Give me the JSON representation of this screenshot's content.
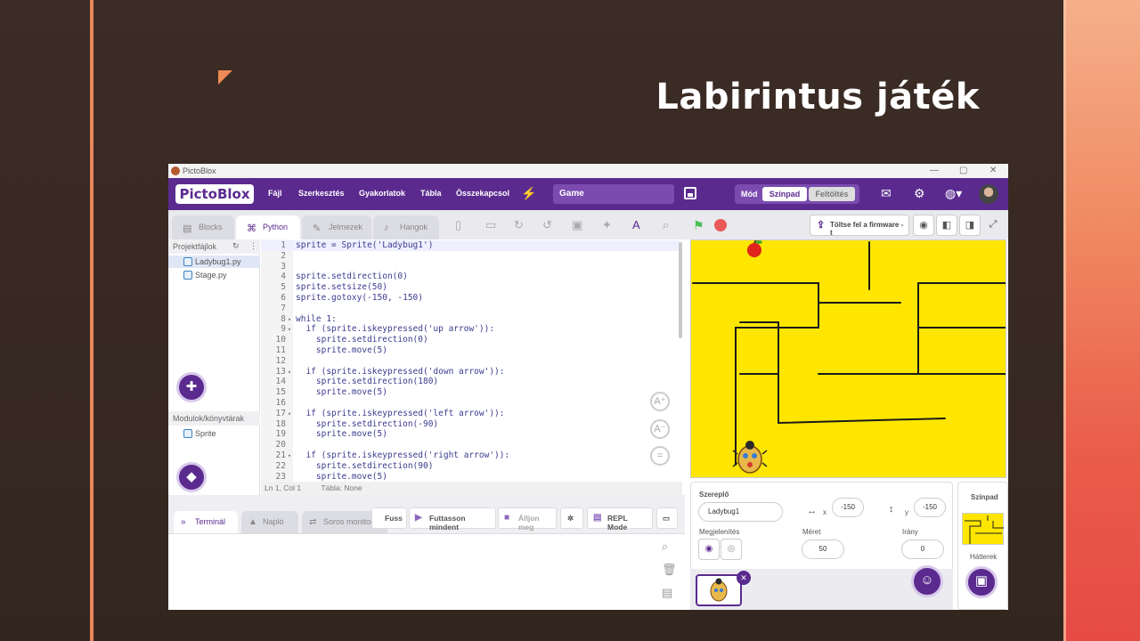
{
  "slide": {
    "title": "Labirintus játék",
    "colors": {
      "background": "#3a2b24",
      "accent": "#e9875c",
      "panel": "#ea5d4a"
    }
  },
  "window": {
    "app_name": "PictoBlox",
    "min": "—",
    "max": "▢",
    "close": "✕"
  },
  "menubar": {
    "logo": "PictoBlox",
    "items": [
      "Fájl",
      "Szerkesztés",
      "Gyakorlatok",
      "Tábla",
      "Összekapcsol"
    ],
    "project_name": "Game",
    "mode_label": "Mód",
    "mode_stage": "Színpad",
    "mode_upload": "Feltöltés",
    "accent": "#5b2a8f"
  },
  "tabs": {
    "blocks": "Blocks",
    "python": "Python",
    "costumes": "Jelmezek",
    "sounds": "Hangok"
  },
  "toolbar": {
    "firmware_label": "Töltse fel a firmware -t"
  },
  "files": {
    "header": "Projektfájlok",
    "items": [
      "Ladybug1.py",
      "Stage.py"
    ],
    "modules_header": "Modulok/könyvtárak",
    "modules": [
      "Sprite"
    ]
  },
  "editor": {
    "lines": [
      {
        "n": "1",
        "fold": "",
        "text": "sprite = Sprite('Ladybug1')"
      },
      {
        "n": "2",
        "fold": "",
        "text": ""
      },
      {
        "n": "3",
        "fold": "",
        "text": ""
      },
      {
        "n": "4",
        "fold": "",
        "text": "sprite.setdirection(0)"
      },
      {
        "n": "5",
        "fold": "",
        "text": "sprite.setsize(50)"
      },
      {
        "n": "6",
        "fold": "",
        "text": "sprite.gotoxy(-150, -150)"
      },
      {
        "n": "7",
        "fold": "",
        "text": ""
      },
      {
        "n": "8",
        "fold": "▾",
        "text": "while 1:"
      },
      {
        "n": "9",
        "fold": "▾",
        "text": "  if (sprite.iskeypressed('up arrow')):"
      },
      {
        "n": "10",
        "fold": "",
        "text": "    sprite.setdirection(0)"
      },
      {
        "n": "11",
        "fold": "",
        "text": "    sprite.move(5)"
      },
      {
        "n": "12",
        "fold": "",
        "text": ""
      },
      {
        "n": "13",
        "fold": "▾",
        "text": "  if (sprite.iskeypressed('down arrow')):"
      },
      {
        "n": "14",
        "fold": "",
        "text": "    sprite.setdirection(180)"
      },
      {
        "n": "15",
        "fold": "",
        "text": "    sprite.move(5)"
      },
      {
        "n": "16",
        "fold": "",
        "text": ""
      },
      {
        "n": "17",
        "fold": "▾",
        "text": "  if (sprite.iskeypressed('left arrow')):"
      },
      {
        "n": "18",
        "fold": "",
        "text": "    sprite.setdirection(-90)"
      },
      {
        "n": "19",
        "fold": "",
        "text": "    sprite.move(5)"
      },
      {
        "n": "20",
        "fold": "",
        "text": ""
      },
      {
        "n": "21",
        "fold": "▾",
        "text": "  if (sprite.iskeypressed('right arrow')):"
      },
      {
        "n": "22",
        "fold": "",
        "text": "    sprite.setdirection(90)"
      },
      {
        "n": "23",
        "fold": "",
        "text": "    sprite.move(5)"
      }
    ],
    "status_position": "Ln 1, Col 1",
    "status_board": "Tábla: None"
  },
  "bottom": {
    "tab_terminal": "Terminál",
    "tab_log": "Napló",
    "tab_serial": "Soros monitor",
    "run": "Fuss",
    "run_all": "Futtasson mindent",
    "stop": "Álljon meg",
    "repl": "REPL Mode"
  },
  "sprite_panel": {
    "sprite_label": "Szereplő",
    "sprite_name": "Ladybug1",
    "x_label": "x",
    "x_value": "-150",
    "y_label": "y",
    "y_value": "-150",
    "show_label": "Megjelenítés",
    "size_label": "Méret",
    "size_value": "50",
    "direction_label": "Irány",
    "direction_value": "0"
  },
  "stage_panel": {
    "title": "Színpad",
    "backdrops_label": "Hátterek"
  },
  "stage_colors": {
    "maze": "#ffe600",
    "wall": "#1a1a1a"
  }
}
